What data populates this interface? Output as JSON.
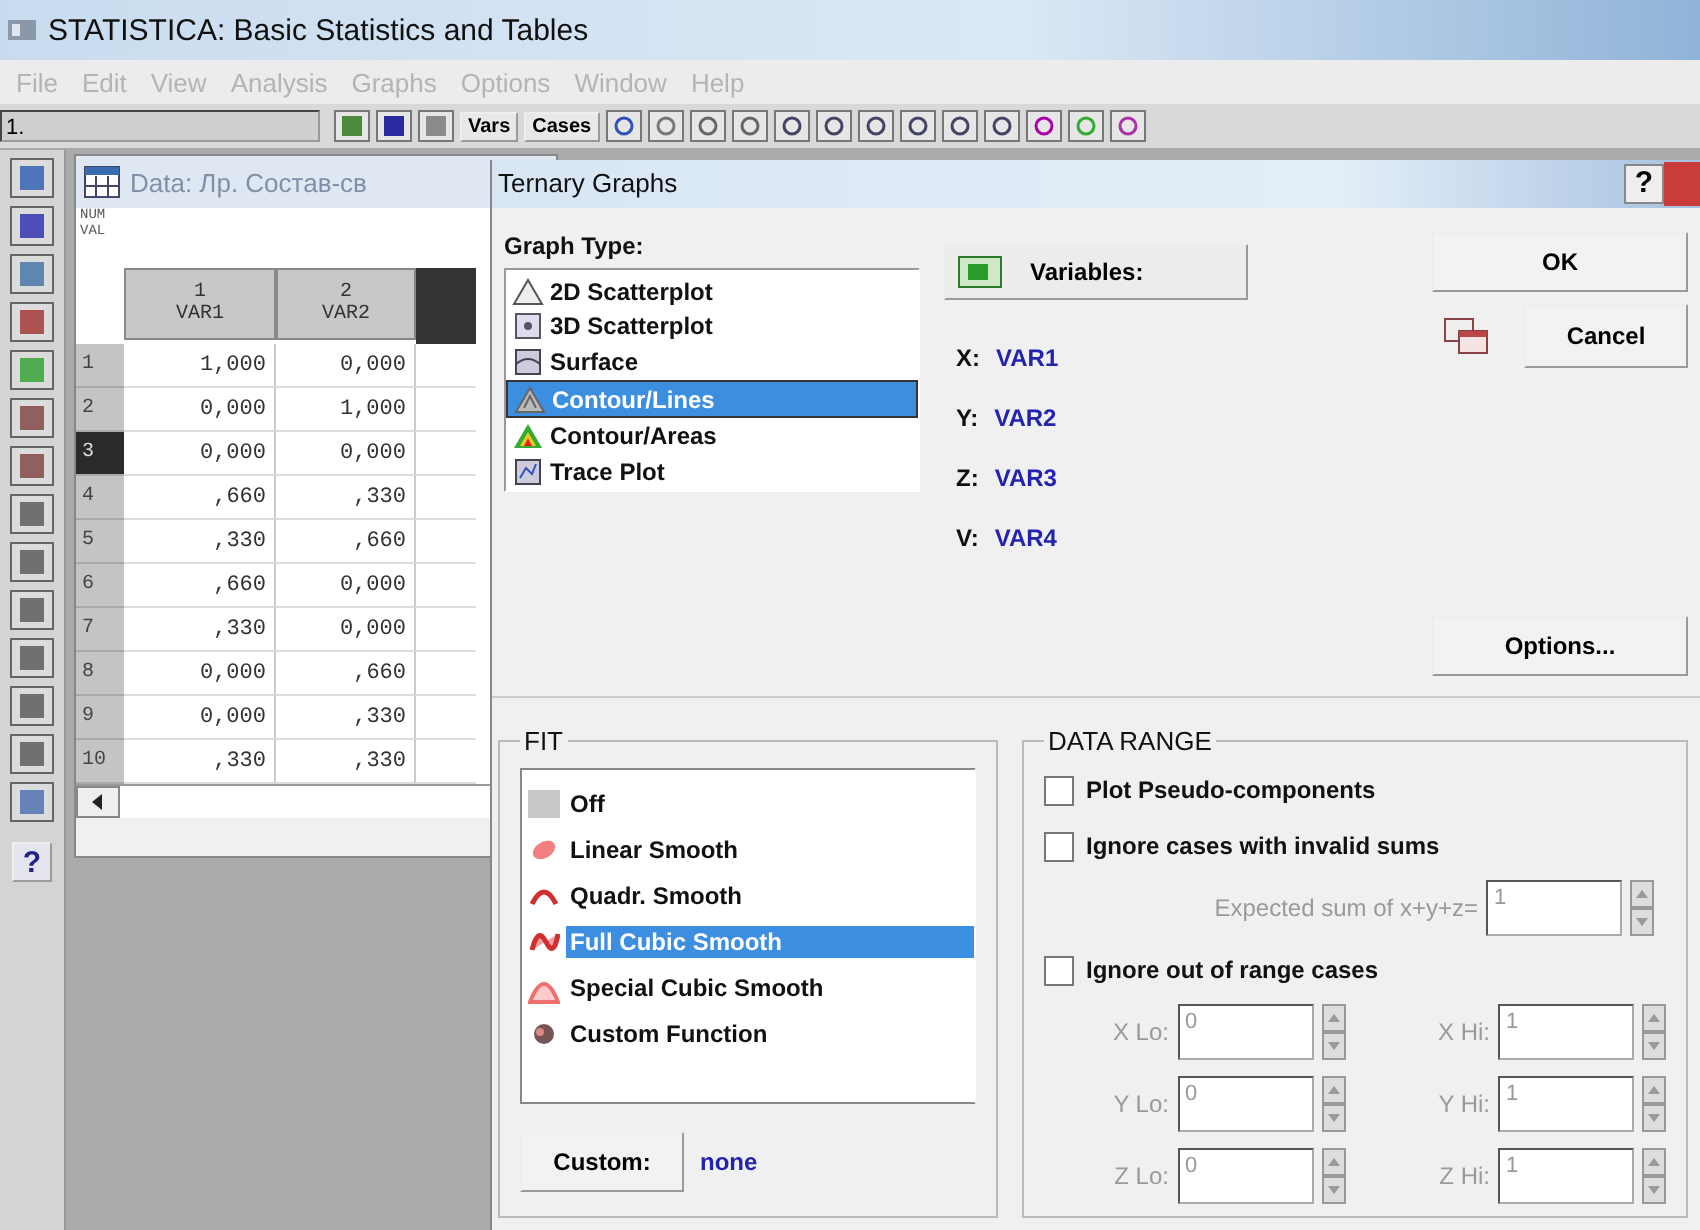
{
  "app": {
    "title": "STATISTICA: Basic Statistics and Tables",
    "menu": [
      {
        "label": "File",
        "disabled": true
      },
      {
        "label": "Edit",
        "disabled": true
      },
      {
        "label": "View",
        "disabled": true
      },
      {
        "label": "Analysis",
        "disabled": true
      },
      {
        "label": "Graphs",
        "disabled": true
      },
      {
        "label": "Options",
        "disabled": true
      },
      {
        "label": "Window",
        "disabled": true
      },
      {
        "label": "Help",
        "disabled": true
      }
    ],
    "toolbar": {
      "field_value": "1.",
      "buttons": [
        "Vars",
        "Cases"
      ]
    }
  },
  "left_toolbar": {
    "help_glyph": "?"
  },
  "data_window": {
    "title": "Data: Лр. Состав-св",
    "corner": [
      "NUM",
      "VAL"
    ],
    "columns": [
      {
        "number": "1",
        "name": "VAR1"
      },
      {
        "number": "2",
        "name": "VAR2"
      }
    ],
    "rows": [
      {
        "number": "1",
        "selected": false,
        "cells": [
          "1,000",
          "0,000"
        ]
      },
      {
        "number": "2",
        "selected": false,
        "cells": [
          "0,000",
          "1,000"
        ]
      },
      {
        "number": "3",
        "selected": true,
        "cells": [
          "0,000",
          "0,000"
        ]
      },
      {
        "number": "4",
        "selected": false,
        "cells": [
          ",660",
          ",330"
        ]
      },
      {
        "number": "5",
        "selected": false,
        "cells": [
          ",330",
          ",660"
        ]
      },
      {
        "number": "6",
        "selected": false,
        "cells": [
          ",660",
          "0,000"
        ]
      },
      {
        "number": "7",
        "selected": false,
        "cells": [
          ",330",
          "0,000"
        ]
      },
      {
        "number": "8",
        "selected": false,
        "cells": [
          "0,000",
          ",660"
        ]
      },
      {
        "number": "9",
        "selected": false,
        "cells": [
          "0,000",
          ",330"
        ]
      },
      {
        "number": "10",
        "selected": false,
        "cells": [
          ",330",
          ",330"
        ]
      }
    ]
  },
  "dialog": {
    "title": "Ternary Graphs",
    "help": "?",
    "graph_type_label": "Graph Type:",
    "graph_types": [
      {
        "label": "2D Scatterplot",
        "kind": "scatter2d",
        "selected": false
      },
      {
        "label": "3D Scatterplot",
        "kind": "scatter3d",
        "selected": false
      },
      {
        "label": "Surface",
        "kind": "surface",
        "selected": false
      },
      {
        "label": "Contour/Lines",
        "kind": "lines",
        "selected": true
      },
      {
        "label": "Contour/Areas",
        "kind": "areas",
        "selected": false
      },
      {
        "label": "Trace Plot",
        "kind": "trace",
        "selected": false
      }
    ],
    "variables_button": "Variables:",
    "variables": [
      {
        "axis": "X:",
        "value": "VAR1"
      },
      {
        "axis": "Y:",
        "value": "VAR2"
      },
      {
        "axis": "Z:",
        "value": "VAR3"
      },
      {
        "axis": "V:",
        "value": "VAR4"
      }
    ],
    "ok": "OK",
    "cancel": "Cancel",
    "options": "Options...",
    "fit": {
      "title": "FIT",
      "items": [
        {
          "label": "Off",
          "kind": "off",
          "selected": false
        },
        {
          "label": "Linear Smooth",
          "kind": "linear",
          "selected": false
        },
        {
          "label": "Quadr. Smooth",
          "kind": "quadratic",
          "selected": false
        },
        {
          "label": "Full Cubic Smooth",
          "kind": "cubic",
          "selected": true
        },
        {
          "label": "Special Cubic Smooth",
          "kind": "special",
          "selected": false
        },
        {
          "label": "Custom Function",
          "kind": "custom",
          "selected": false
        }
      ],
      "custom_button": "Custom:",
      "custom_value": "none"
    },
    "data_range": {
      "title": "DATA RANGE",
      "checks": [
        {
          "label": "Plot Pseudo-components",
          "checked": false
        },
        {
          "label": "Ignore cases with invalid sums",
          "checked": false
        },
        {
          "label": "Ignore out of range cases",
          "checked": false
        }
      ],
      "expected": {
        "label": "Expected sum of x+y+z=",
        "value": "1",
        "disabled": true
      },
      "limits": [
        {
          "label": "X Lo:",
          "value": "0",
          "disabled": true
        },
        {
          "label": "X Hi:",
          "value": "1",
          "disabled": true
        },
        {
          "label": "Y Lo:",
          "value": "0",
          "disabled": true
        },
        {
          "label": "Y Hi:",
          "value": "1",
          "disabled": true
        },
        {
          "label": "Z Lo:",
          "value": "0",
          "disabled": true
        },
        {
          "label": "Z Hi:",
          "value": "1",
          "disabled": true
        }
      ]
    }
  }
}
